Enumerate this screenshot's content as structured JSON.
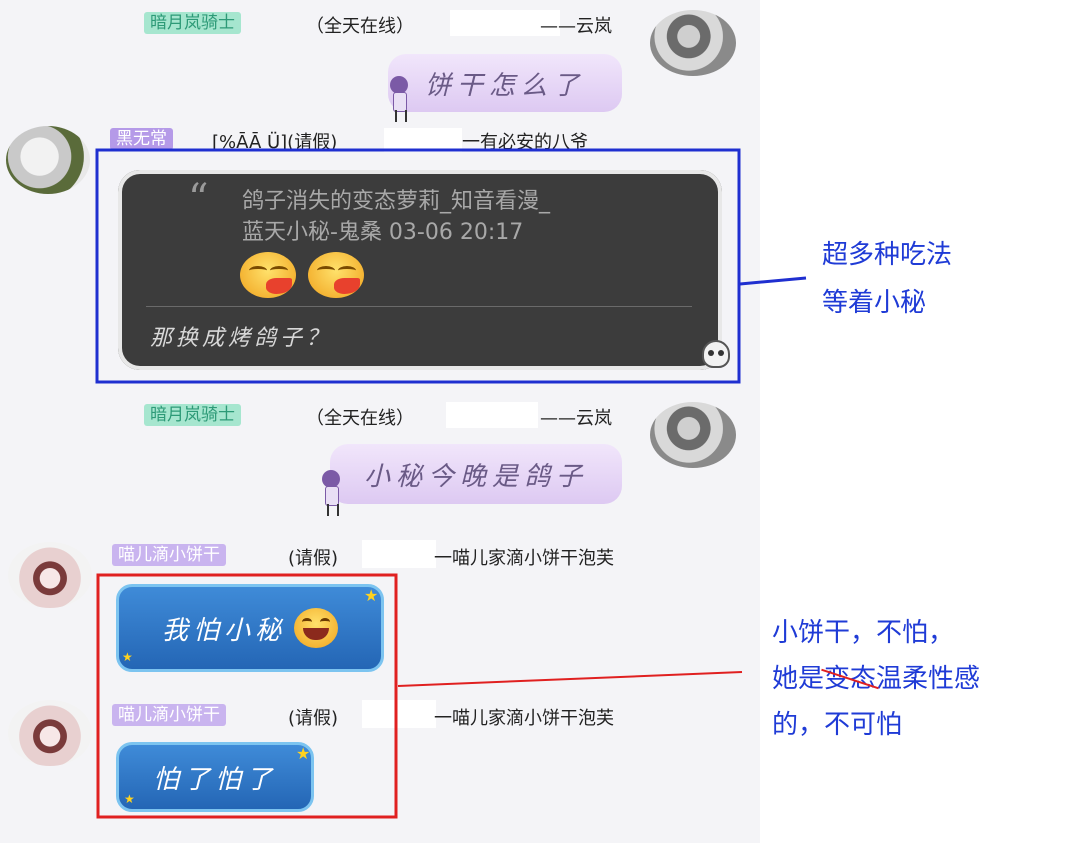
{
  "messages": [
    {
      "sender_tag": "暗月岚骑士",
      "status": "（全天在线）",
      "sender_suffix": "——云岚",
      "bubble": "饼干怎么了"
    },
    {
      "sender_tag": "黑无常",
      "status": "[%ĀĀ Ü](请假)",
      "sender_suffix": "一有必安的八爷",
      "quote_line1": "鸽子消失的变态萝莉_知音看漫_",
      "quote_line2": "蓝天小秘-鬼桑 03-06 20:17",
      "reply": "那换成烤鸽子？"
    },
    {
      "sender_tag": "暗月岚骑士",
      "status": "（全天在线）",
      "sender_suffix": "——云岚",
      "bubble": "小秘今晚是鸽子"
    },
    {
      "sender_tag": "喵儿滴小饼干",
      "status": "(请假)",
      "sender_suffix": "一喵儿家滴小饼干泡芙",
      "bubble": "我怕小秘"
    },
    {
      "sender_tag": "喵儿滴小饼干",
      "status": "(请假)",
      "sender_suffix": "一喵儿家滴小饼干泡芙",
      "bubble": "怕了怕了"
    }
  ],
  "annotations": {
    "blue_note_line1": "超多种吃法",
    "blue_note_line2": "等着小秘",
    "red_note_line1": "小饼干，不怕，",
    "red_note_line2_a": "她是",
    "red_note_line2_struck": "变态",
    "red_note_line2_b": "温柔性感",
    "red_note_line3": "的，不可怕"
  },
  "colors": {
    "blue_box": "#1f2fd0",
    "red_box": "#e02020",
    "green_tag": "#a6e6cf",
    "purple_tag": "#c9b4ef",
    "note_text": "#1f3bd6"
  },
  "icons": [
    "avatar",
    "chibi-girl-sticker",
    "laughing-crying-emoji",
    "skull-icon",
    "star-icon"
  ]
}
